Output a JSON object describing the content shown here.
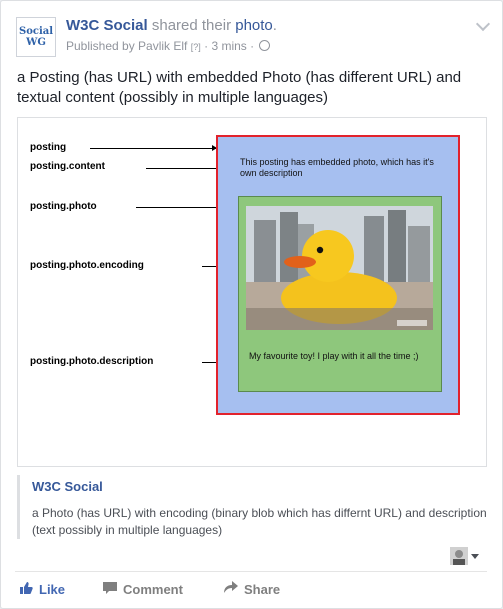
{
  "header": {
    "avatar_line1": "Social",
    "avatar_line2": "WG",
    "author": "W3C Social",
    "action_text": " shared their ",
    "object": "photo",
    "object_end": ".",
    "published_by": "Published by Pavlik Elf",
    "help_marker": "[?]",
    "separator": " · ",
    "time": "3 mins",
    "separator2": " · "
  },
  "post": {
    "text": "a Posting (has URL) with embedded Photo (has different URL) and textual content (possibly in multiple languages)"
  },
  "diagram": {
    "labels": [
      "posting",
      "posting.content",
      "posting.photo",
      "posting.photo.encoding",
      "posting.photo.description"
    ],
    "posting_text": "This posting has embedded photo, which has it's own description",
    "photo_description": "My favourite toy! I play with it all the time ;)"
  },
  "link": {
    "title": "W3C Social",
    "description": "a Photo (has URL) with encoding (binary blob which has differnt URL) and description (text possibly in multiple languages)"
  },
  "actions": {
    "like": "Like",
    "comment": "Comment",
    "share": "Share"
  },
  "colors": {
    "link_blue": "#365899",
    "posting_bg": "#a6bff0",
    "posting_border": "#e2222c",
    "photo_bg": "#8ec77c"
  }
}
